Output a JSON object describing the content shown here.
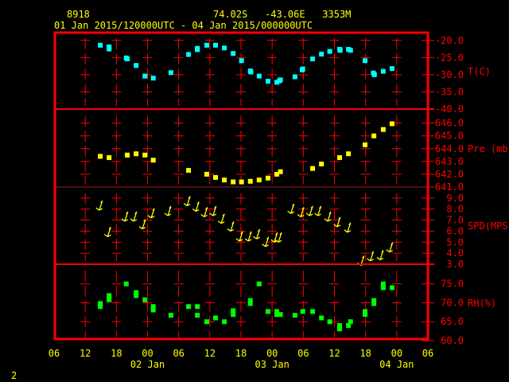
{
  "header": {
    "station": "8918",
    "location": "74.02S   -43.06E   3353M",
    "period": "01 Jan 2015/120000UTC - 04 Jan 2015/000000UTC"
  },
  "footer": {
    "page": "2"
  },
  "colors": {
    "frame": "#ff0000",
    "text": "#ffff00",
    "temp": "#00ffff",
    "pres": "#ffff00",
    "wind": "#ffff00",
    "rh": "#00ff00"
  },
  "chart_data": {
    "type": "scatter",
    "x_unit": "hours since 01 Jan 06 UTC",
    "xlim": [
      0,
      72
    ],
    "x_ticks": [
      "06",
      "12",
      "18",
      "00",
      "06",
      "12",
      "18",
      "00",
      "06",
      "12",
      "18",
      "00",
      "06"
    ],
    "date_labels": [
      {
        "hour": 18,
        "label": "02 Jan"
      },
      {
        "hour": 42,
        "label": "03 Jan"
      },
      {
        "hour": 66,
        "label": "04 Jan"
      }
    ],
    "panels": [
      {
        "name": "temperature",
        "label": "T(C)",
        "ylim": [
          -40,
          -17.5
        ],
        "ticks": [
          -20,
          -25,
          -30,
          -35,
          -40
        ],
        "tick_labels": [
          "-20.0",
          "-25.0",
          "-30.0",
          "-35.0",
          "-40.0"
        ],
        "marker": "square",
        "points": [
          [
            8.9,
            -21.4
          ],
          [
            10.6,
            -21.9
          ],
          [
            10.6,
            -22.5
          ],
          [
            13.9,
            -25.1
          ],
          [
            14.1,
            -25.4
          ],
          [
            15.8,
            -27.3
          ],
          [
            17.5,
            -30.4
          ],
          [
            19.1,
            -31.0
          ],
          [
            22.5,
            -29.4
          ],
          [
            25.9,
            -24.1
          ],
          [
            27.6,
            -22.7
          ],
          [
            27.6,
            -22.3
          ],
          [
            29.4,
            -21.4
          ],
          [
            31.1,
            -21.4
          ],
          [
            32.8,
            -22.2
          ],
          [
            34.5,
            -23.8
          ],
          [
            36.1,
            -25.9
          ],
          [
            37.8,
            -28.9
          ],
          [
            37.9,
            -29.2
          ],
          [
            39.5,
            -30.4
          ],
          [
            41.2,
            -31.9
          ],
          [
            42.9,
            -32.2
          ],
          [
            43.4,
            -31.8
          ],
          [
            43.6,
            -31.5
          ],
          [
            46.4,
            -30.6
          ],
          [
            47.8,
            -28.6
          ],
          [
            47.9,
            -28.3
          ],
          [
            49.8,
            -25.4
          ],
          [
            51.5,
            -24.0
          ],
          [
            53.1,
            -23.2
          ],
          [
            55.0,
            -22.6
          ],
          [
            55.1,
            -22.9
          ],
          [
            56.7,
            -22.6
          ],
          [
            57.1,
            -22.9
          ],
          [
            59.9,
            -25.9
          ],
          [
            61.5,
            -29.5
          ],
          [
            61.7,
            -30.0
          ],
          [
            63.4,
            -29.0
          ],
          [
            65.1,
            -28.2
          ]
        ]
      },
      {
        "name": "pressure",
        "label": "Pre (mb)",
        "ylim": [
          641,
          647.1
        ],
        "ticks": [
          646,
          645,
          644,
          643,
          642,
          641
        ],
        "tick_labels": [
          "646.0",
          "645.0",
          "644.0",
          "643.0",
          "642.0",
          "641.0"
        ],
        "marker": "square",
        "points": [
          [
            8.9,
            643.4
          ],
          [
            10.6,
            643.3
          ],
          [
            14.1,
            643.5
          ],
          [
            15.8,
            643.6
          ],
          [
            17.5,
            643.5
          ],
          [
            19.1,
            643.1
          ],
          [
            25.9,
            642.3
          ],
          [
            29.4,
            642.0
          ],
          [
            31.1,
            641.75
          ],
          [
            32.8,
            641.55
          ],
          [
            34.5,
            641.4
          ],
          [
            36.1,
            641.4
          ],
          [
            37.8,
            641.45
          ],
          [
            39.5,
            641.55
          ],
          [
            41.2,
            641.7
          ],
          [
            42.9,
            642.0
          ],
          [
            43.6,
            642.2
          ],
          [
            49.8,
            642.45
          ],
          [
            51.5,
            642.8
          ],
          [
            55.0,
            643.3
          ],
          [
            56.7,
            643.6
          ],
          [
            59.9,
            644.3
          ],
          [
            61.6,
            645.0
          ],
          [
            63.4,
            645.5
          ],
          [
            65.1,
            645.95
          ]
        ]
      },
      {
        "name": "wind_speed",
        "label": "SPD(MPS)",
        "ylim": [
          3,
          10
        ],
        "ticks": [
          9,
          8,
          7,
          6,
          5,
          4,
          3
        ],
        "tick_labels": [
          "9.0",
          "8.0",
          "7.0",
          "6.0",
          "5.0",
          "4.0",
          "3.0"
        ],
        "marker": "wind-arrow",
        "points": [
          [
            8.7,
            7.9
          ],
          [
            10.3,
            5.5
          ],
          [
            13.6,
            6.9
          ],
          [
            15.3,
            6.9
          ],
          [
            17.0,
            6.2
          ],
          [
            18.7,
            7.2
          ],
          [
            21.9,
            7.4
          ],
          [
            25.6,
            8.3
          ],
          [
            27.3,
            7.8
          ],
          [
            28.9,
            7.3
          ],
          [
            30.6,
            7.4
          ],
          [
            32.2,
            6.7
          ],
          [
            34.0,
            6.0
          ],
          [
            35.7,
            5.1
          ],
          [
            37.4,
            5.1
          ],
          [
            39.0,
            5.3
          ],
          [
            40.7,
            4.6
          ],
          [
            42.4,
            5.0
          ],
          [
            43.2,
            5.0
          ],
          [
            45.6,
            7.6
          ],
          [
            47.5,
            7.3
          ],
          [
            49.2,
            7.4
          ],
          [
            50.8,
            7.4
          ],
          [
            52.7,
            6.9
          ],
          [
            54.5,
            6.4
          ],
          [
            56.5,
            5.9
          ],
          [
            59.1,
            2.9
          ],
          [
            60.9,
            3.3
          ],
          [
            62.8,
            3.4
          ],
          [
            64.6,
            4.1
          ]
        ]
      },
      {
        "name": "relative_humidity",
        "label": "RH(%)",
        "ylim": [
          60,
          80.2
        ],
        "ticks": [
          75,
          70,
          65,
          60
        ],
        "tick_labels": [
          "75.0",
          "70.0",
          "65.0",
          "60.0"
        ],
        "marker": "square",
        "points": [
          [
            8.9,
            69.8
          ],
          [
            8.9,
            69.0
          ],
          [
            10.6,
            71.9
          ],
          [
            10.6,
            70.8
          ],
          [
            13.9,
            75.0
          ],
          [
            15.8,
            72.7
          ],
          [
            15.8,
            71.9
          ],
          [
            17.5,
            70.8
          ],
          [
            19.1,
            69.0
          ],
          [
            19.1,
            68.1
          ],
          [
            22.5,
            66.7
          ],
          [
            25.9,
            69.0
          ],
          [
            27.6,
            69.0
          ],
          [
            27.6,
            66.7
          ],
          [
            29.4,
            65.0
          ],
          [
            31.1,
            66.0
          ],
          [
            32.8,
            65.0
          ],
          [
            34.5,
            66.9
          ],
          [
            34.5,
            67.9
          ],
          [
            37.8,
            69.8
          ],
          [
            37.8,
            70.6
          ],
          [
            39.5,
            75.0
          ],
          [
            41.2,
            67.7
          ],
          [
            42.9,
            67.7
          ],
          [
            42.9,
            66.9
          ],
          [
            43.6,
            66.9
          ],
          [
            46.4,
            66.7
          ],
          [
            47.9,
            67.7
          ],
          [
            49.8,
            67.7
          ],
          [
            51.5,
            66.0
          ],
          [
            53.1,
            65.0
          ],
          [
            55.0,
            64.0
          ],
          [
            55.0,
            63.1
          ],
          [
            56.7,
            64.0
          ],
          [
            57.1,
            65.0
          ],
          [
            59.9,
            67.7
          ],
          [
            59.9,
            66.9
          ],
          [
            61.6,
            70.6
          ],
          [
            61.6,
            69.8
          ],
          [
            63.4,
            75.0
          ],
          [
            63.4,
            74.0
          ],
          [
            65.1,
            74.0
          ]
        ]
      }
    ]
  }
}
